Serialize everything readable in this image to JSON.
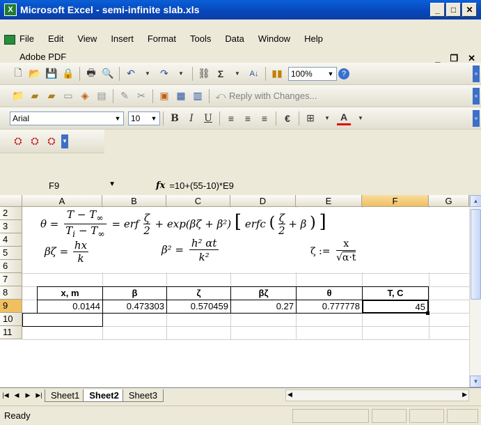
{
  "window": {
    "title": "Microsoft Excel - semi-infinite slab.xls"
  },
  "menu": {
    "items": [
      "File",
      "Edit",
      "View",
      "Insert",
      "Format",
      "Tools",
      "Data",
      "Window",
      "Help"
    ],
    "adobe": "Adobe PDF"
  },
  "toolbar": {
    "zoom": "100%",
    "reply": "Reply with Changes...",
    "font": "Arial",
    "size": "10"
  },
  "formula_bar": {
    "cell_ref": "F9",
    "fx": "fx",
    "formula": "=10+(55-10)*E9"
  },
  "sheet": {
    "columns": [
      "A",
      "B",
      "C",
      "D",
      "E",
      "F",
      "G"
    ],
    "rows": [
      "2",
      "3",
      "4",
      "5",
      "6",
      "7",
      "8",
      "9",
      "10",
      "11"
    ],
    "headers": [
      "x, m",
      "β",
      "ζ",
      "βζ",
      "θ",
      "T, C"
    ],
    "values": [
      "0.0144",
      "0.473303",
      "0.570459",
      "0.27",
      "0.777778",
      "45"
    ]
  },
  "equations": {
    "theta": "θ = (T − T∞)/(Ti − T∞) = erf ζ/2 + exp(βζ + β²)[erfc(ζ/2 + β)]",
    "bz": "βζ = hx/k",
    "b2": "β² = h²αt/k²",
    "zeta": "ζ := x/√(α·t)"
  },
  "tabs": [
    "Sheet1",
    "Sheet2",
    "Sheet3"
  ],
  "active_tab": "Sheet2",
  "status": "Ready"
}
